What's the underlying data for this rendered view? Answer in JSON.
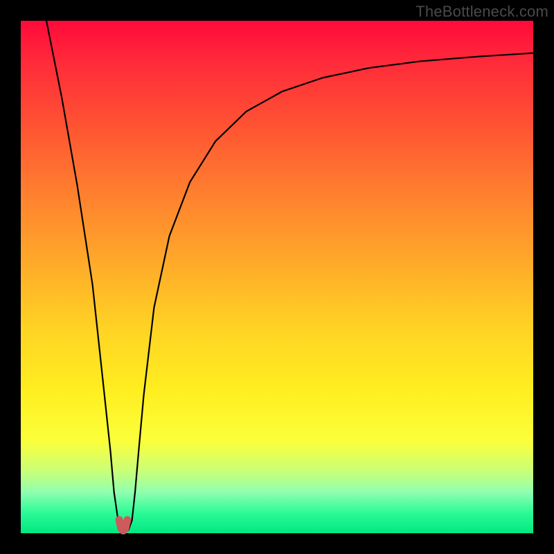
{
  "watermark": "TheBottleneck.com",
  "chart_data": {
    "type": "line",
    "title": "",
    "xlabel": "",
    "ylabel": "",
    "xlim": [
      0,
      100
    ],
    "ylim": [
      0,
      100
    ],
    "grid": false,
    "legend": false,
    "series": [
      {
        "name": "bottleneck-curve",
        "x": [
          5,
          8,
          11,
          14,
          16,
          17.5,
          18.2,
          19,
          19.6,
          20.3,
          21,
          21.7,
          22.3,
          23,
          24,
          26,
          29,
          33,
          38,
          44,
          51,
          59,
          68,
          78,
          89,
          100
        ],
        "values": [
          100,
          85,
          68,
          48.5,
          30,
          16,
          8,
          2.5,
          0.6,
          0.4,
          0.6,
          2.5,
          8,
          16,
          27,
          44,
          58,
          68.5,
          76.5,
          82.3,
          86.2,
          88.9,
          90.8,
          92.1,
          93.0,
          93.7
        ]
      },
      {
        "name": "min-marker",
        "x": [
          19.2,
          19.6,
          20.0,
          20.4,
          20.8
        ],
        "values": [
          2.6,
          0.9,
          0.5,
          0.9,
          2.6
        ]
      }
    ],
    "colors": {
      "curve": "#000000",
      "marker": "#cc5a5a"
    }
  }
}
